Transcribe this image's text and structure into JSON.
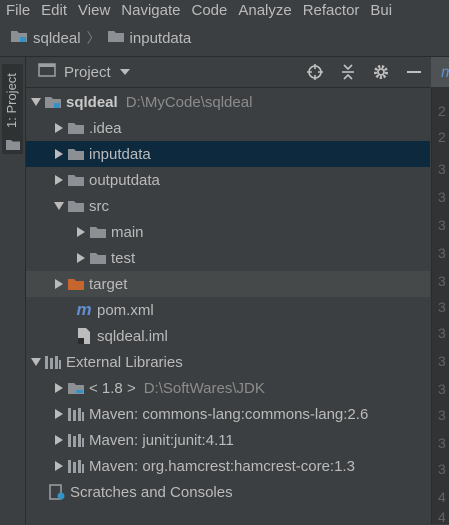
{
  "menu": [
    {
      "label": "File"
    },
    {
      "label": "Edit"
    },
    {
      "label": "View"
    },
    {
      "label": "Navigate"
    },
    {
      "label": "Code"
    },
    {
      "label": "Analyze"
    },
    {
      "label": "Refactor"
    },
    {
      "label": "Bui"
    }
  ],
  "breadcrumb": {
    "project": "sqldeal",
    "folder": "inputdata"
  },
  "side_tab": {
    "label": "1: Project"
  },
  "panel": {
    "title": "Project"
  },
  "tree": [
    {
      "label": "sqldeal",
      "path": "D:\\MyCode\\sqldeal"
    },
    {
      "label": ".idea"
    },
    {
      "label": "inputdata"
    },
    {
      "label": "outputdata"
    },
    {
      "label": "src"
    },
    {
      "label": "main"
    },
    {
      "label": "test"
    },
    {
      "label": "target"
    },
    {
      "label": "pom.xml"
    },
    {
      "label": "sqldeal.iml"
    },
    {
      "label": "External Libraries"
    },
    {
      "label": "< 1.8 >",
      "path": "D:\\SoftWares\\JDK"
    },
    {
      "label": "Maven: commons-lang:commons-lang:2.6"
    },
    {
      "label": "Maven: junit:junit:4.11"
    },
    {
      "label": "Maven: org.hamcrest:hamcrest-core:1.3"
    },
    {
      "label": "Scratches and Consoles"
    }
  ],
  "gutter": [
    "2",
    "2",
    "3",
    "3",
    "3",
    "3",
    "3",
    "3",
    "3",
    "3",
    "3",
    "3",
    "3",
    "3",
    "4",
    "4"
  ],
  "colors": {
    "selection": "#0d293e",
    "folder": "#8c9094",
    "excluded_folder": "#c6652d",
    "accent": "#3592c4"
  }
}
